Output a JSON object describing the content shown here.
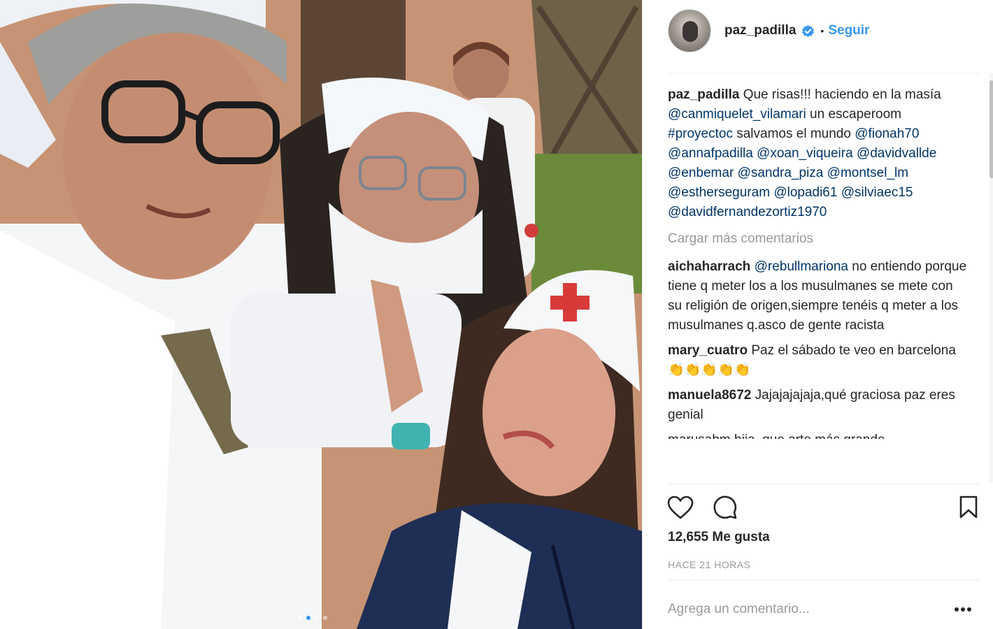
{
  "post": {
    "owner": "paz_padilla",
    "separator": "•",
    "follow_label": "Seguir",
    "carousel": {
      "count": 4,
      "active_index": 1
    }
  },
  "caption": {
    "user": "paz_padilla",
    "parts": [
      {
        "text": "Que risas!!! haciendo en la masía ",
        "mention": false
      },
      {
        "text": "@canmiquelet_vilamari",
        "mention": true
      },
      {
        "text": " un escaperoom ",
        "mention": false
      },
      {
        "text": "#proyectoc",
        "mention": true
      },
      {
        "text": " salvamos el mundo ",
        "mention": false
      },
      {
        "text": "@fionah70",
        "mention": true
      },
      {
        "text": " ",
        "mention": false
      },
      {
        "text": "@annafpadilla",
        "mention": true
      },
      {
        "text": " ",
        "mention": false
      },
      {
        "text": "@xoan_viqueira",
        "mention": true
      },
      {
        "text": " ",
        "mention": false
      },
      {
        "text": "@davidvallde",
        "mention": true
      },
      {
        "text": " ",
        "mention": false
      },
      {
        "text": "@enbemar",
        "mention": true
      },
      {
        "text": " ",
        "mention": false
      },
      {
        "text": "@sandra_piza",
        "mention": true
      },
      {
        "text": " ",
        "mention": false
      },
      {
        "text": "@montsel_lm",
        "mention": true
      },
      {
        "text": " ",
        "mention": false
      },
      {
        "text": "@estherseguram",
        "mention": true
      },
      {
        "text": " ",
        "mention": false
      },
      {
        "text": "@lopadi61",
        "mention": true
      },
      {
        "text": " ",
        "mention": false
      },
      {
        "text": "@silviaec15",
        "mention": true
      },
      {
        "text": " ",
        "mention": false
      },
      {
        "text": "@davidfernandezortiz1970",
        "mention": true
      }
    ]
  },
  "load_more_label": "Cargar más comentarios",
  "comments": [
    {
      "user": "aichaharrach",
      "mention": "@rebullmariona",
      "text": " no entiendo porque tiene q meter los a los musulmanes se mete con su religión de origen,siempre tenéis q meter a los musulmanes q.asco de gente racista"
    },
    {
      "user": "mary_cuatro",
      "mention": "",
      "text": "Paz el sábado te veo en barcelona 👏👏👏👏👏"
    },
    {
      "user": "manuela8672",
      "mention": "",
      "text": "Jajajajajaja,qué graciosa paz eres genial"
    },
    {
      "user": "marusabm",
      "mention": "",
      "text": "hija, que arte más grande"
    }
  ],
  "likes_label": "12,655 Me gusta",
  "time_label": "HACE 21 HORAS",
  "add_comment_placeholder": "Agrega un comentario...",
  "icons": {
    "like": "heart-icon",
    "comment": "speech-bubble-icon",
    "save": "bookmark-icon",
    "more": "ellipsis-icon",
    "verified": "verified-badge-icon"
  },
  "colors": {
    "link_blue": "#3897f0",
    "mention_navy": "#003569",
    "muted_gray": "#999999",
    "text": "#262626"
  }
}
